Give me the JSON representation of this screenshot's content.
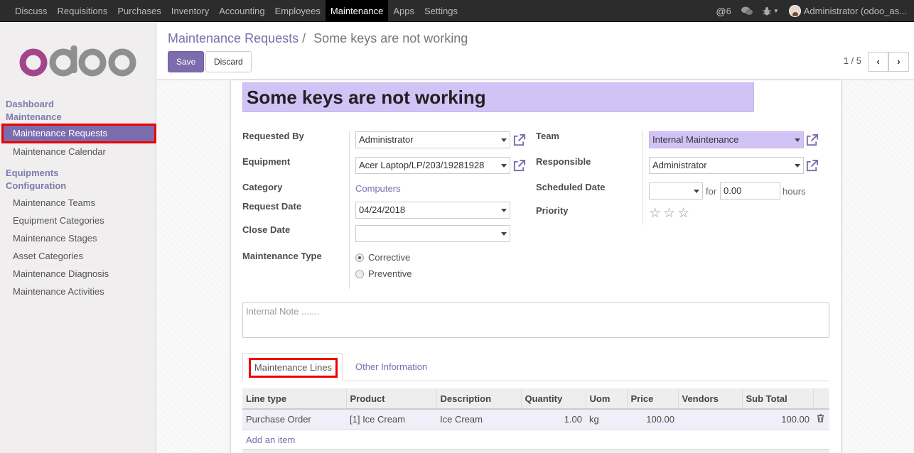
{
  "topbar": {
    "menu": [
      "Discuss",
      "Requisitions",
      "Purchases",
      "Inventory",
      "Accounting",
      "Employees",
      "Maintenance",
      "Apps",
      "Settings"
    ],
    "active": "Maintenance",
    "mentions_count": "6",
    "user": "Administrator (odoo_as..."
  },
  "sidebar": {
    "section1": "Dashboard",
    "section2": "Maintenance",
    "items_maintenance": [
      "Maintenance Requests",
      "Maintenance Calendar"
    ],
    "section3": "Equipments",
    "section4": "Configuration",
    "items_config": [
      "Maintenance Teams",
      "Equipment Categories",
      "Maintenance Stages",
      "Asset Categories",
      "Maintenance Diagnosis",
      "Maintenance Activities"
    ]
  },
  "control": {
    "breadcrumb_parent": "Maintenance Requests",
    "breadcrumb_sep": "/",
    "breadcrumb_current": "Some keys are not working",
    "save": "Save",
    "discard": "Discard",
    "pager": "1 / 5"
  },
  "form": {
    "title": "Some keys are not working",
    "requested_by_label": "Requested By",
    "requested_by": "Administrator",
    "equipment_label": "Equipment",
    "equipment": "Acer Laptop/LP/203/19281928",
    "category_label": "Category",
    "category": "Computers",
    "request_date_label": "Request Date",
    "request_date": "04/24/2018",
    "close_date_label": "Close Date",
    "close_date": "",
    "maintenance_type_label": "Maintenance Type",
    "type_corrective": "Corrective",
    "type_preventive": "Preventive",
    "team_label": "Team",
    "team": "Internal Maintenance",
    "responsible_label": "Responsible",
    "responsible": "Administrator",
    "scheduled_date_label": "Scheduled Date",
    "for_label": "for",
    "duration": "0.00",
    "hours_label": "hours",
    "priority_label": "Priority",
    "note_placeholder": "Internal Note ......."
  },
  "tabs": [
    "Maintenance Lines",
    "Other Information"
  ],
  "lines": {
    "headers": [
      "Line type",
      "Product",
      "Description",
      "Quantity",
      "Uom",
      "Price",
      "Vendors",
      "Sub Total"
    ],
    "rows": [
      [
        "Purchase Order",
        "[1] Ice Cream",
        "Ice Cream",
        "1.00",
        "kg",
        "100.00",
        "",
        "100.00"
      ]
    ],
    "add_item": "Add an item"
  },
  "colors": {
    "accent": "#7c6cae",
    "highlight": "#e00000"
  }
}
